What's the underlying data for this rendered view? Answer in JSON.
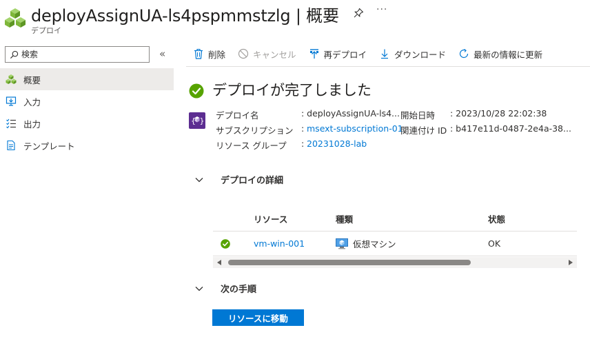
{
  "header": {
    "title": "deployAssignUA-ls4pspmmstzlg | 概要",
    "subtitle": "デプロイ",
    "pin_icon": "pin-icon",
    "more_label": "···"
  },
  "sidebar": {
    "search_placeholder": "検索",
    "collapse_label": "«",
    "items": [
      {
        "label": "概要",
        "icon": "overview-cubes-icon",
        "active": true
      },
      {
        "label": "入力",
        "icon": "input-icon",
        "active": false
      },
      {
        "label": "出力",
        "icon": "output-icon",
        "active": false
      },
      {
        "label": "テンプレート",
        "icon": "template-icon",
        "active": false
      }
    ]
  },
  "toolbar": {
    "delete_label": "削除",
    "cancel_label": "キャンセル",
    "redeploy_label": "再デプロイ",
    "download_label": "ダウンロード",
    "refresh_label": "最新の情報に更新"
  },
  "status": {
    "title": "デプロイが完了しました"
  },
  "details": {
    "deploy_name_label": "デプロイ名",
    "deploy_name_value": ": deployAssignUA-ls4...",
    "subscription_label": "サブスクリプション",
    "subscription_sep": ":",
    "subscription_value": "msext-subscription-01",
    "resource_group_label": "リソース グループ",
    "resource_group_sep": ":",
    "resource_group_value": "20231028-lab",
    "start_time_label": "開始日時",
    "start_time_value": ": 2023/10/28 22:02:38",
    "correlation_label": "関連付け ID",
    "correlation_value": ": b417e11d-0487-2e4a-38..."
  },
  "deploy_details_section": {
    "title": "デプロイの詳細"
  },
  "table": {
    "headers": [
      "リソース",
      "種類",
      "状態"
    ],
    "rows": [
      {
        "resource": "vm-win-001",
        "type": "仮想マシン",
        "status": "OK"
      }
    ]
  },
  "next_steps_section": {
    "title": "次の手順",
    "button_label": "リソースに移動"
  },
  "colors": {
    "accent": "#0078d4",
    "success": "#57a300",
    "deploy_icon": "#5c2d91"
  }
}
